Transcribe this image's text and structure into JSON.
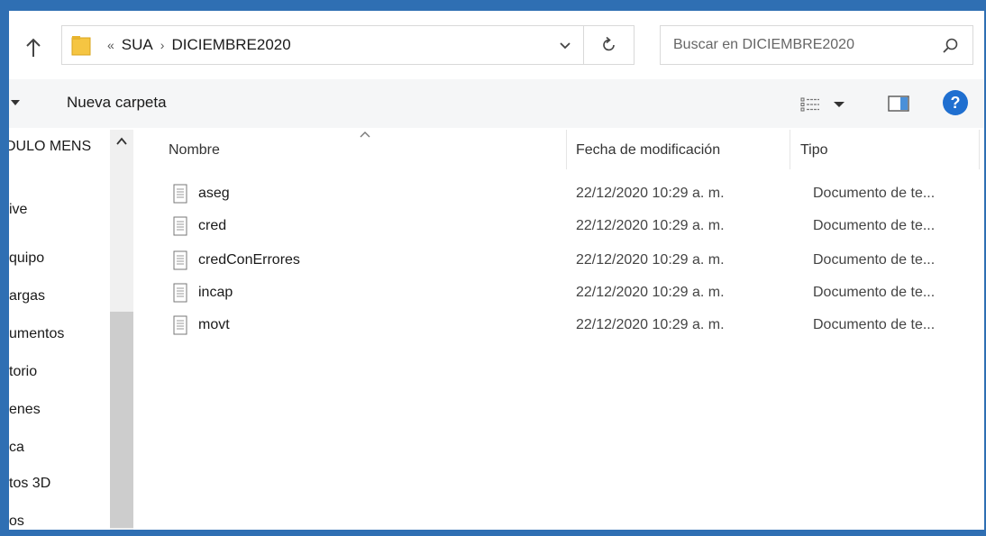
{
  "address": {
    "breadcrumb_overflow": "«",
    "crumbs": [
      "SUA",
      "DICIEMBRE2020"
    ],
    "separator": "›"
  },
  "search": {
    "placeholder": "Buscar en DICIEMBRE2020"
  },
  "command_bar": {
    "new_folder_label": "Nueva carpeta"
  },
  "nav_pane": {
    "items": [
      "DULO MENS",
      "ive",
      "quipo",
      "argas",
      "umentos",
      "torio",
      "enes",
      "ca",
      "tos 3D",
      "os"
    ]
  },
  "columns": {
    "name": "Nombre",
    "date": "Fecha de modificación",
    "type": "Tipo"
  },
  "files": [
    {
      "name": "aseg",
      "date": "22/12/2020 10:29 a. m.",
      "type": "Documento de te..."
    },
    {
      "name": "cred",
      "date": "22/12/2020 10:29 a. m.",
      "type": "Documento de te..."
    },
    {
      "name": "credConErrores",
      "date": "22/12/2020 10:29 a. m.",
      "type": "Documento de te..."
    },
    {
      "name": "incap",
      "date": "22/12/2020 10:29 a. m.",
      "type": "Documento de te..."
    },
    {
      "name": "movt",
      "date": "22/12/2020 10:29 a. m.",
      "type": "Documento de te..."
    }
  ],
  "help_label": "?",
  "colors": {
    "frame_border": "#2f6fb3",
    "folder": "#f5c542",
    "help": "#1f6fd0",
    "command_bar": "#f5f6f7"
  }
}
